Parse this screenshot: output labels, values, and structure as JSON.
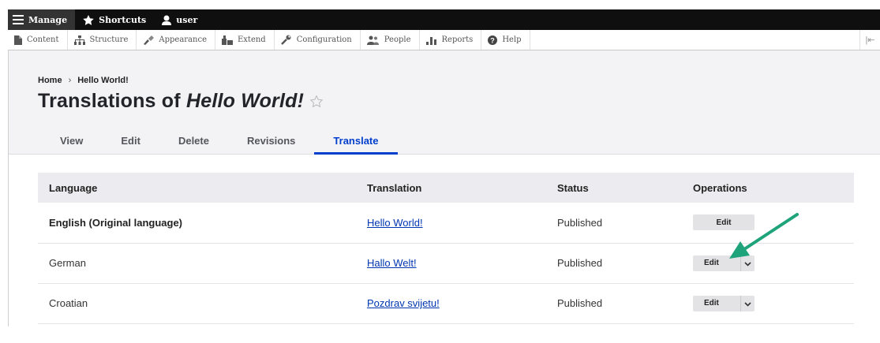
{
  "toolbar": {
    "items": [
      {
        "label": "Manage",
        "icon": "hamburger-icon"
      },
      {
        "label": "Shortcuts",
        "icon": "star-icon"
      },
      {
        "label": "user",
        "icon": "user-icon"
      }
    ]
  },
  "tray": {
    "items": [
      {
        "label": "Content",
        "icon": "content-icon"
      },
      {
        "label": "Structure",
        "icon": "structure-icon"
      },
      {
        "label": "Appearance",
        "icon": "appearance-icon"
      },
      {
        "label": "Extend",
        "icon": "extend-icon"
      },
      {
        "label": "Configuration",
        "icon": "wrench-icon"
      },
      {
        "label": "People",
        "icon": "people-icon"
      },
      {
        "label": "Reports",
        "icon": "reports-icon"
      },
      {
        "label": "Help",
        "icon": "help-icon"
      }
    ],
    "end_glyph": "|⇤"
  },
  "breadcrumb": {
    "home": "Home",
    "separator": "›",
    "current": "Hello World!"
  },
  "page": {
    "title_prefix": "Translations of",
    "title_node": "Hello World!"
  },
  "tabs": [
    {
      "label": "View",
      "active": false
    },
    {
      "label": "Edit",
      "active": false
    },
    {
      "label": "Delete",
      "active": false
    },
    {
      "label": "Revisions",
      "active": false
    },
    {
      "label": "Translate",
      "active": true
    }
  ],
  "table": {
    "headers": [
      "Language",
      "Translation",
      "Status",
      "Operations"
    ],
    "rows": [
      {
        "language": "English (Original language)",
        "translation": "Hello World!",
        "status": "Published",
        "operation": "Edit",
        "has_dropdown": false
      },
      {
        "language": "German",
        "translation": "Hallo Welt!",
        "status": "Published",
        "operation": "Edit",
        "has_dropdown": true
      },
      {
        "language": "Croatian",
        "translation": "Pozdrav svijetu!",
        "status": "Published",
        "operation": "Edit",
        "has_dropdown": true
      }
    ]
  },
  "colors": {
    "accent": "#003ecc",
    "link": "#0036b1",
    "arrow": "#1fa37a",
    "toolbar_bg": "#0f0f0f"
  }
}
